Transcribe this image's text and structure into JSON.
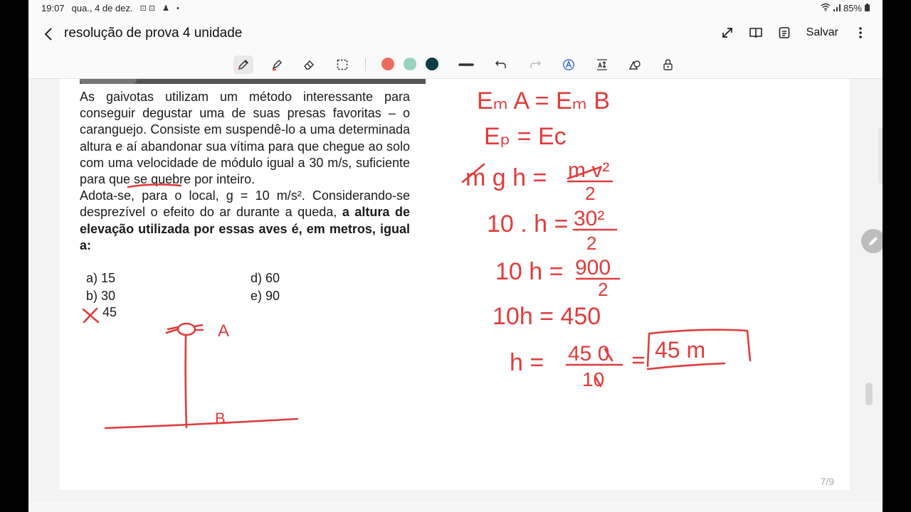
{
  "status_bar": {
    "time": "19:07",
    "date": "qua., 4 de dez.",
    "battery": "85%"
  },
  "header": {
    "title": "resolução de prova 4 unidade",
    "save_label": "Salvar"
  },
  "toolbar": {
    "tools": [
      "pen-icon",
      "highlighter-icon",
      "eraser-icon",
      "lasso-select-icon"
    ],
    "colors": [
      "#ee6a5f",
      "#97d3c0",
      "#0d3b47"
    ],
    "actions": [
      "stroke-width-icon",
      "undo-icon",
      "redo-icon",
      "text-recognition-icon",
      "spacing-icon",
      "shapes-icon",
      "lock-icon"
    ]
  },
  "question": {
    "paragraph1": "As gaivotas utilizam um método interessante para conseguir degustar uma de suas presas favoritas – o caranguejo. Consiste em suspendê-lo a uma determinada altura e aí abandonar sua vítima para que chegue ao solo com uma velocidade de módulo igual a 30 m/s, suficiente para que se quebre por inteiro.",
    "paragraph2_normal": "Adota-se, para o local, g = 10 m/s². Considerando-se desprezível o efeito do ar durante a queda, ",
    "paragraph2_bold": "a altura de elevação utilizada por essas aves é, em metros, igual a:",
    "options": {
      "a": "a) 15",
      "b": "b) 30",
      "c": "45",
      "d": "d) 60",
      "e": "e) 90"
    }
  },
  "handwriting": {
    "line1": "Eₘ A = Eₘ B",
    "line2": "Eₚ = Eᴄ",
    "line3_left": "m g h =",
    "line3_right_num": "m v²",
    "line3_right_den": "2",
    "line4_left": "10 . h =",
    "line4_num": "30²",
    "line4_den": "2",
    "line5_left": "10 h =",
    "line5_num": "900",
    "line5_den": "2",
    "line6": "10h = 450",
    "line7_left": "h =",
    "line7_num": "45 0",
    "line7_den": "10",
    "line7_result": "45 m",
    "sketch_label_a": "A",
    "sketch_label_b": "B"
  },
  "page_number": "7/9"
}
